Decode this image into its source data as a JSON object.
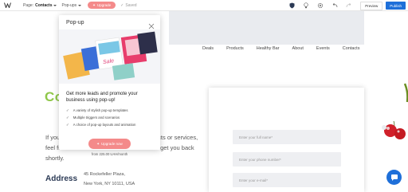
{
  "toolbar": {
    "page_prefix": "Page:",
    "page_name": "Contacts",
    "popups_label": "Pop-ups",
    "upgrade_label": "Upgrade",
    "saved_label": "Saved",
    "preview_label": "Preview",
    "publish_label": "Publish",
    "icons": [
      "shield-icon",
      "bulb-icon",
      "gear-icon",
      "undo-icon",
      "redo-icon"
    ]
  },
  "nav": {
    "items": [
      "Deals",
      "Products",
      "Healthy Bar",
      "About",
      "Events",
      "Contacts"
    ]
  },
  "page": {
    "heading_partial": "Co",
    "body_left_line1": "If you",
    "body_left_line2": "feel fr",
    "body_left_line3": "shortly.",
    "body_right_line1": "ucts or services,",
    "body_right_line2": "ill get you back",
    "address_label": "Address",
    "address_line1": "45 Rockefeller Plaza,",
    "address_line2": "New York, NY 10111, USA"
  },
  "form": {
    "fields": [
      {
        "placeholder": "Enter your full name*"
      },
      {
        "placeholder": "Enter your phone number*"
      },
      {
        "placeholder": "Enter your e-mail*"
      }
    ]
  },
  "popup": {
    "title": "Pop-up",
    "banner_sale_text": "Sale",
    "headline": "Get more leads and promote your business using pop-up!",
    "features": [
      "A variety of stylish pop-up templates",
      "Multiple triggers and scenarios",
      "A choice of pop-up layouts and animation"
    ],
    "upgrade_label": "Upgrade now",
    "price": "from 225.00 UAH/month"
  },
  "colors": {
    "accent_blue": "#1e6fd9",
    "upgrade_pink": "#f48a8a",
    "heading_green": "#8fc74a",
    "address_navy": "#2b3a55"
  }
}
